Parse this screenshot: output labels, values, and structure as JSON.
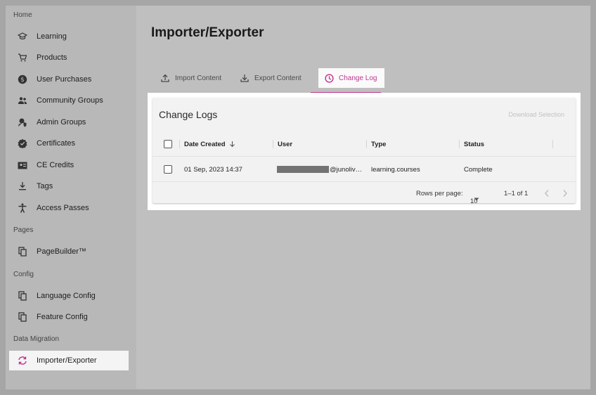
{
  "sidebar": {
    "sections": {
      "home": "Home",
      "pages": "Pages",
      "config": "Config",
      "data_migration": "Data Migration"
    },
    "items": [
      {
        "label": "Learning",
        "icon": "graduation-cap-icon"
      },
      {
        "label": "Products",
        "icon": "cart-icon"
      },
      {
        "label": "User Purchases",
        "icon": "dollar-icon"
      },
      {
        "label": "Community Groups",
        "icon": "group-icon"
      },
      {
        "label": "Admin Groups",
        "icon": "admin-shield-icon"
      },
      {
        "label": "Certificates",
        "icon": "badge-icon"
      },
      {
        "label": "CE Credits",
        "icon": "card-icon"
      },
      {
        "label": "Tags",
        "icon": "tag-icon"
      },
      {
        "label": "Access Passes",
        "icon": "accessibility-icon"
      },
      {
        "label": "PageBuilder™",
        "icon": "copy-icon"
      },
      {
        "label": "Language Config",
        "icon": "copy-icon"
      },
      {
        "label": "Feature Config",
        "icon": "copy-icon"
      },
      {
        "label": "Importer/Exporter",
        "icon": "sync-icon",
        "active": true
      }
    ]
  },
  "main": {
    "title": "Importer/Exporter",
    "tabs": [
      {
        "label": "Import Content",
        "icon": "upload-icon"
      },
      {
        "label": "Export Content",
        "icon": "download-icon"
      },
      {
        "label": "Change Log",
        "icon": "clock-icon",
        "active": true
      }
    ]
  },
  "changelog": {
    "title": "Change Logs",
    "download_label": "Download Selection",
    "columns": [
      "Date Created",
      "User",
      "Type",
      "Status"
    ],
    "rows": [
      {
        "date": "01 Sep, 2023 14:37",
        "user": "@junoliv…",
        "type": "learning.courses",
        "status": "Complete"
      }
    ],
    "footer": {
      "rows_per_page_label": "Rows per page:",
      "rows_per_page_value": "10",
      "range": "1–1 of 1"
    }
  },
  "colors": {
    "accent": "#c1338f",
    "sidebar_bg": "#b8b8b8",
    "main_bg": "#bfbfbf",
    "card_bg": "#f2f2f2"
  }
}
